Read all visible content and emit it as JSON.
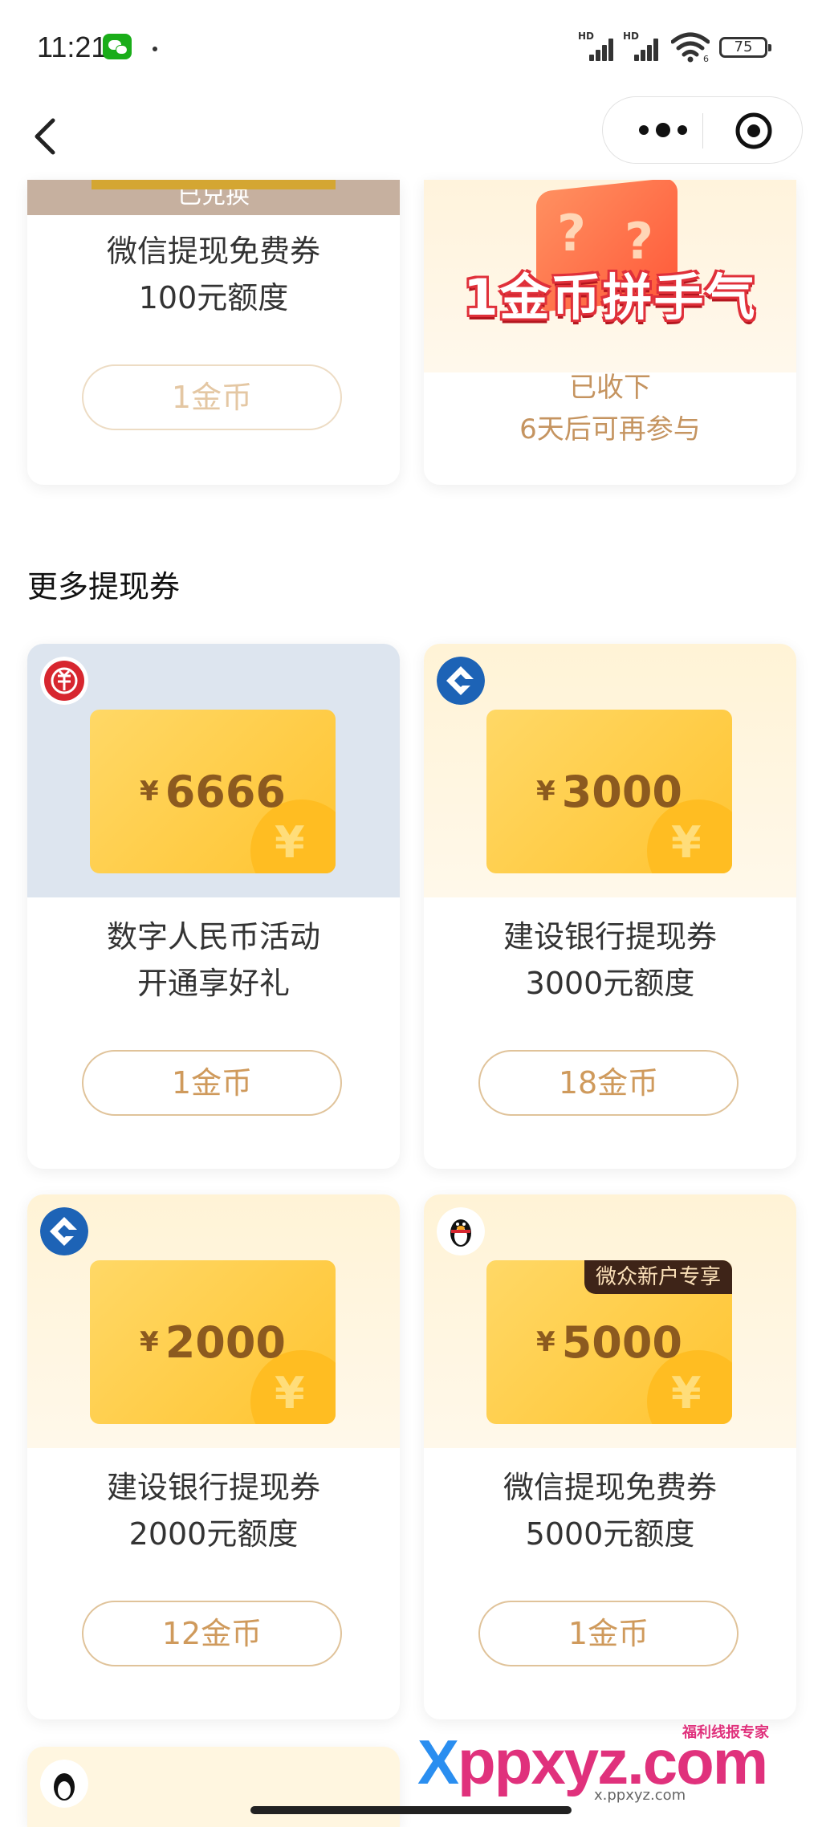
{
  "status_bar": {
    "time": "11:21",
    "signal1_label": "HD",
    "signal2_label": "HD",
    "wifi_badge": "6",
    "battery": "75"
  },
  "nav": {
    "back_icon": "chevron-left-icon",
    "more_icon": "more-dots-icon",
    "close_icon": "target-close-icon"
  },
  "top_cards": {
    "left": {
      "redeemed_label": "已兑换",
      "title_line1": "微信提现免费券",
      "title_line2": "100元额度",
      "button": "1金币"
    },
    "right": {
      "banner": "1金币拼手气",
      "status_line1": "已收下",
      "status_line2": "6天后可再参与"
    }
  },
  "section_title": "更多提现券",
  "vouchers": [
    {
      "currency": "¥",
      "amount": "6666",
      "coin_glyph": "¥",
      "title_line1": "数字人民币活动",
      "title_line2": "开通享好礼",
      "button": "1金币",
      "logo": "digital-rmb-logo",
      "bg": "#dde5ef"
    },
    {
      "currency": "¥",
      "amount": "3000",
      "coin_glyph": "¥",
      "title_line1": "建设银行提现券",
      "title_line2": "3000元额度",
      "button": "18金币",
      "logo": "ccb-logo",
      "bg": "#fff3d8"
    },
    {
      "currency": "¥",
      "amount": "2000",
      "coin_glyph": "¥",
      "title_line1": "建设银行提现券",
      "title_line2": "2000元额度",
      "button": "12金币",
      "logo": "ccb-logo",
      "bg": "#fff3d8"
    },
    {
      "currency": "¥",
      "amount": "5000",
      "coin_glyph": "¥",
      "title_line1": "微信提现免费券",
      "title_line2": "5000元额度",
      "button": "1金币",
      "logo": "webank-logo",
      "badge": "微众新户专享",
      "bg": "#fff3d8"
    }
  ],
  "watermark": {
    "main": "ppxyz.com",
    "prefix": "X",
    "top": "福利线报专家",
    "bottom": "x.ppxyz.com"
  },
  "colors": {
    "accent": "#cf9a5c",
    "voucher": "#ffc431",
    "ccb_blue": "#1d63b6",
    "digital_red": "#d7262f"
  }
}
